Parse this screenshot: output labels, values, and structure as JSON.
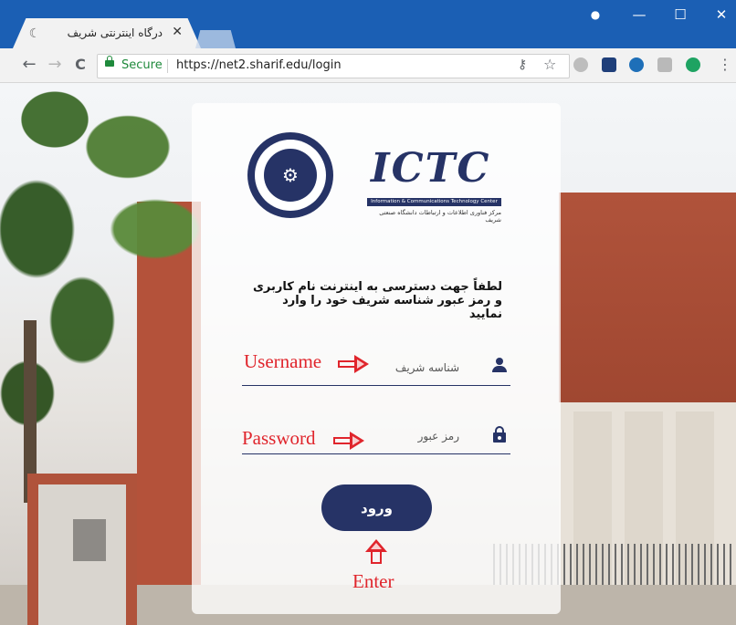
{
  "browser": {
    "tab_title": "درگاه اینترنتی شریف",
    "tab_close": "✕",
    "tab_favicon": "☾",
    "window_profile": "●",
    "window_min": "—",
    "window_max": "☐",
    "window_close": "✕",
    "back": "←",
    "forward": "→",
    "reload": "C",
    "secure_label": "Secure",
    "url": "https://net2.sharif.edu/login",
    "key_icon": "⚷",
    "star_icon": "☆",
    "menu_icon": "⋮",
    "colors": {
      "titlebar": "#1b5fb4",
      "secure": "#1f8a3c"
    }
  },
  "login": {
    "logo_text": "ICTC",
    "logo_subtitle_bar": "Information & Communications Technology Center",
    "logo_subtitle_fa": "مرکز فناوری اطلاعات و ارتباطات دانشگاه صنعتی شریف",
    "seal_glyph": "⚙",
    "instructions": "لطفاً جهت دسترسی به اینترنت نام کاربری و رمز عبور شناسه شریف خود را وارد نمایید",
    "username_placeholder": "شناسه شریف",
    "password_placeholder": "رمز عبور",
    "submit_label": "ورود",
    "colors": {
      "primary": "#263366",
      "annotation": "#e0252c"
    }
  },
  "annotations": {
    "username": "Username",
    "password": "Password",
    "enter": "Enter"
  }
}
